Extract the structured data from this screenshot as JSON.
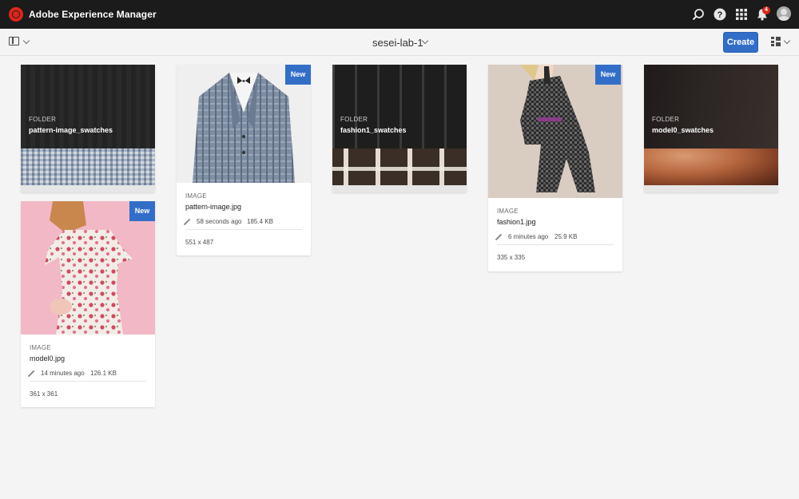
{
  "shell": {
    "title": "Adobe Experience Manager",
    "icons": [
      "search-icon",
      "help-icon",
      "apps-grid-icon",
      "bell-icon",
      "user-avatar"
    ],
    "notification_count": "4",
    "brand_color": "#e1251b"
  },
  "actionbar": {
    "breadcrumb": "sesei-lab-1",
    "create_label": "Create",
    "accent_color": "#326ec8"
  },
  "cards": {
    "pattern_swatches": {
      "kind": "FOLDER",
      "name": "pattern-image_swatches"
    },
    "fashion1_swatches": {
      "kind": "FOLDER",
      "name": "fashion1_swatches"
    },
    "model0_swatches": {
      "kind": "FOLDER",
      "name": "model0_swatches"
    },
    "pattern_image": {
      "badge": "New",
      "kind": "IMAGE",
      "name": "pattern-image.jpg",
      "modified": "58 seconds ago",
      "size": "185.4 KB",
      "dimensions": "551 x 487"
    },
    "fashion1": {
      "badge": "New",
      "kind": "IMAGE",
      "name": "fashion1.jpg",
      "modified": "6 minutes ago",
      "size": "25.9 KB",
      "dimensions": "335 x 335"
    },
    "model0": {
      "badge": "New",
      "kind": "IMAGE",
      "name": "model0.jpg",
      "modified": "14 minutes ago",
      "size": "126.1 KB",
      "dimensions": "361 x 361"
    }
  }
}
